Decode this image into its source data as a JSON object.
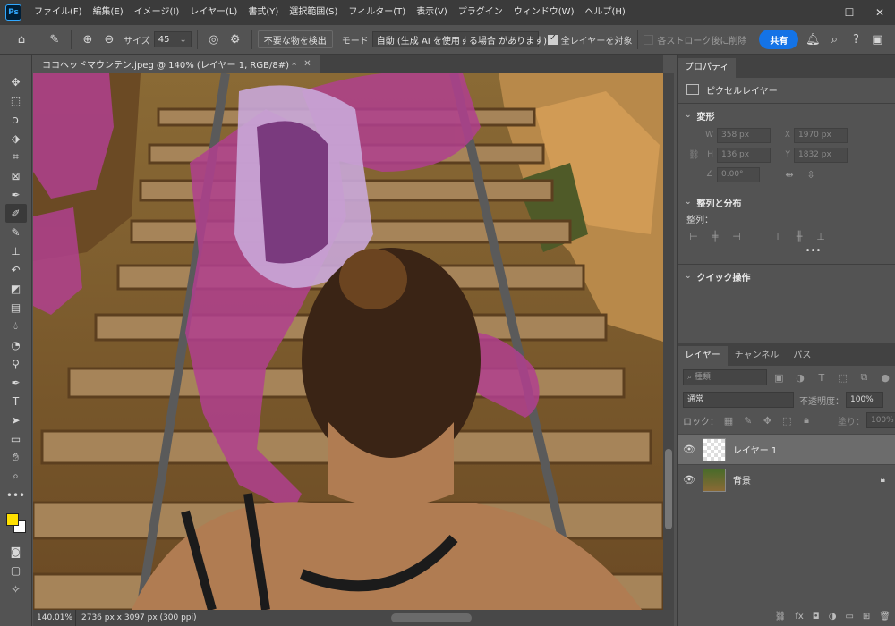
{
  "app": {
    "logo": "Ps",
    "menus": [
      "ファイル(F)",
      "編集(E)",
      "イメージ(I)",
      "レイヤー(L)",
      "書式(Y)",
      "選択範囲(S)",
      "フィルター(T)",
      "表示(V)",
      "プラグイン",
      "ウィンドウ(W)",
      "ヘルプ(H)"
    ]
  },
  "options": {
    "size_label": "サイズ",
    "size_value": "45",
    "detect_button": "不要な物を検出",
    "mode_label": "モード",
    "mode_value": "自動 (生成 AI を使用する場合 があります)",
    "all_layers_label": "全レイヤーを対象",
    "after_stroke_label": "各ストローク後に削除",
    "share_button": "共有"
  },
  "document": {
    "tab_title": "ココヘッドマウンテン.jpeg @ 140% (レイヤー 1, RGB/8#) *",
    "zoom": "140.01%",
    "dimensions": "2736 px x 3097 px (300 ppi)"
  },
  "properties": {
    "tab": "プロパティ",
    "pixel_layer": "ピクセルレイヤー",
    "transform_title": "変形",
    "w_label": "W",
    "w_value": "358 px",
    "x_label": "X",
    "x_value": "1970 px",
    "h_label": "H",
    "h_value": "136 px",
    "y_label": "Y",
    "y_value": "1832 px",
    "angle_value": "0.00°",
    "align_title": "整列と分布",
    "align_label": "整列：",
    "more": "•••",
    "quick_title": "クイック操作"
  },
  "layers": {
    "tabs": [
      "レイヤー",
      "チャンネル",
      "パス"
    ],
    "filter_placeholder": "種類",
    "blend_mode": "通常",
    "opacity_label": "不透明度：",
    "opacity_value": "100%",
    "lock_label": "ロック：",
    "fill_label": "塗り：",
    "fill_value": "100%",
    "items": [
      {
        "name": "レイヤー 1",
        "selected": true
      },
      {
        "name": "背景",
        "selected": false
      }
    ]
  },
  "colors": {
    "foreground": "#ffe000",
    "background": "#ffffff",
    "accent": "#1473e6",
    "mask_overlay": "#b0408e"
  }
}
